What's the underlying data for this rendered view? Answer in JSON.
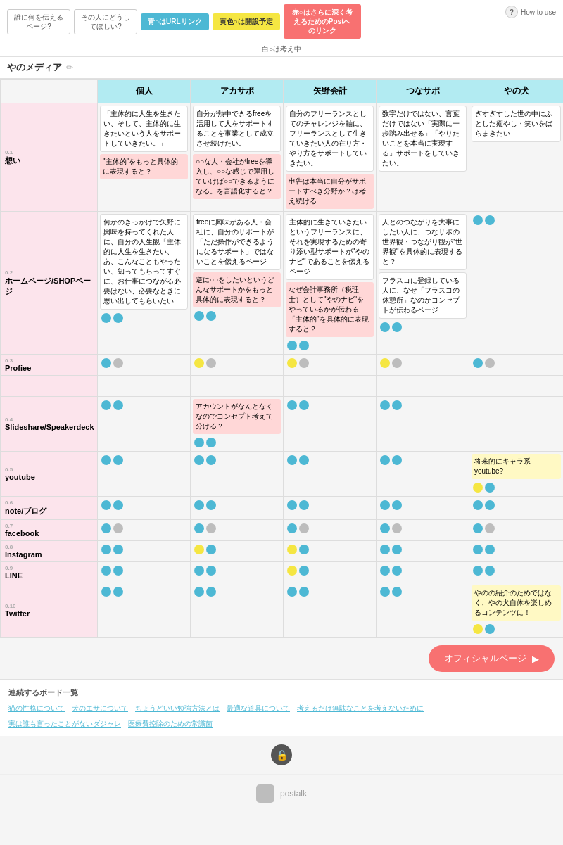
{
  "header": {
    "col_labels": [
      "誰に何を伝えるページ?",
      "その人にどうしてほしい?",
      "青○はURLリンク",
      "黄色○は開設予定",
      "赤○はさらに深く考えるためのPostへのリンク"
    ],
    "white_label": "白○は考え中",
    "howto": "How to use"
  },
  "page_title": "やのメディア",
  "col_headers": [
    "個人",
    "アカサポ",
    "矢野会計",
    "つなサポ",
    "やの犬"
  ],
  "rows": [
    {
      "id": "r1",
      "num": "0.1",
      "label": "想い",
      "cells": [
        {
          "cards": [
            {
              "text": "「主体的に人生を生きたい、そして、主体的に生きたいという人をサポートしていきたい。」",
              "type": "white"
            },
            {
              "text": "\"主体的\"をもっと具体的に表現すると？",
              "type": "pink"
            }
          ],
          "dots": []
        },
        {
          "cards": [
            {
              "text": "自分が熱中できるfreeを活用して人をサポートすることを事業として成立させ続けたい。",
              "type": "white"
            },
            {
              "text": "○○な人・会社がfreeを導入し、○○な感じで運用していけば○○できるようになる。を言語化すると？",
              "type": "pink"
            }
          ],
          "dots": []
        },
        {
          "cards": [
            {
              "text": "自分のフリーランスとしてのチャレンジを軸に、フリーランスとして生きていきたい人の在り方・やり方をサポートしていきたい。",
              "type": "white"
            },
            {
              "text": "申告は本当に自分がサポートすべき分野か？は考え続ける",
              "type": "pink"
            }
          ],
          "dots": []
        },
        {
          "cards": [
            {
              "text": "数字だけではない、言葉だけではない「実際に一歩踏み出せる」「やりたいことを本当に実現する」サポートをしていきたい。",
              "type": "white"
            }
          ],
          "dots": []
        },
        {
          "cards": [
            {
              "text": "ぎすぎすした世の中にふとした癒やし・笑いをばらまきたい",
              "type": "white"
            }
          ],
          "dots": []
        }
      ]
    },
    {
      "id": "r2",
      "num": "0.2",
      "label": "ホームページ/SHOPページ",
      "cells": [
        {
          "cards": [
            {
              "text": "何かのきっかけで矢野に興味を持ってくれた人に、自分の人生観「主体的に人生を生きたい、あ、こんなこともやったい、知ってもらってすぐに、お仕事につながる必要はない、必要なときに思い出してもらいたい",
              "type": "white"
            }
          ],
          "dots": [
            {
              "type": "teal"
            },
            {
              "type": "teal"
            }
          ]
        },
        {
          "cards": [
            {
              "text": "freeに興味がある人・会社に、自分のサポートが「ただ操作ができるようになるサポート」ではないことを伝えるページ",
              "type": "white"
            },
            {
              "text": "逆に○○をしたいという\nどんなサポートかをもっと具体的に表現すると？",
              "type": "pink"
            }
          ],
          "dots": [
            {
              "type": "teal"
            },
            {
              "type": "teal"
            }
          ]
        },
        {
          "cards": [
            {
              "text": "主体的に生きていきたいというフリーランスに、それを実現するための寄り添い型サポートが\"やのナビ\"であることを伝えるページ",
              "type": "white"
            },
            {
              "text": "なぜ会計事務所（税理士）として\"やのナビ\"をやっているかが伝わる「主体的\"を具体的に表現すると？",
              "type": "pink"
            }
          ],
          "dots": [
            {
              "type": "teal"
            },
            {
              "type": "teal"
            }
          ]
        },
        {
          "cards": [
            {
              "text": "人とのつながりを大事にしたい人に、つなサポの世界観・つながり観が\"\"世界観\"を具体的に表現すると？",
              "type": "white"
            },
            {
              "text": "フラスコに登録している人に、なぜ「フラスコの休憩所」なのかコンセプトが伝わるページ",
              "type": "white"
            }
          ],
          "dots": [
            {
              "type": "teal"
            },
            {
              "type": "teal"
            }
          ]
        },
        {
          "cards": [],
          "dots": [
            {
              "type": "teal"
            },
            {
              "type": "teal"
            }
          ]
        }
      ]
    },
    {
      "id": "r3",
      "num": "0.3",
      "label": "Profiee",
      "cells": [
        {
          "cards": [],
          "dots": [
            {
              "type": "teal"
            },
            {
              "type": "gray"
            }
          ]
        },
        {
          "cards": [],
          "dots": [
            {
              "type": "yellow"
            },
            {
              "type": "gray"
            }
          ]
        },
        {
          "cards": [],
          "dots": [
            {
              "type": "yellow"
            },
            {
              "type": "gray"
            }
          ]
        },
        {
          "cards": [],
          "dots": [
            {
              "type": "yellow"
            },
            {
              "type": "gray"
            }
          ]
        },
        {
          "cards": [],
          "dots": [
            {
              "type": "teal"
            },
            {
              "type": "gray"
            }
          ]
        }
      ]
    },
    {
      "id": "r4",
      "num": "",
      "label": "",
      "cells": [
        {
          "cards": [],
          "dots": []
        },
        {
          "cards": [],
          "dots": []
        },
        {
          "cards": [],
          "dots": []
        },
        {
          "cards": [],
          "dots": []
        },
        {
          "cards": [],
          "dots": []
        }
      ]
    },
    {
      "id": "r5",
      "num": "0.4",
      "label": "Slideshare/Speakerdeck",
      "cells": [
        {
          "cards": [],
          "dots": [
            {
              "type": "teal"
            },
            {
              "type": "teal"
            }
          ]
        },
        {
          "cards": [
            {
              "text": "アカウントがなんとなくなのでコンセプト考えて分ける？",
              "type": "pink"
            }
          ],
          "dots": [
            {
              "type": "teal"
            },
            {
              "type": "teal"
            }
          ]
        },
        {
          "cards": [],
          "dots": [
            {
              "type": "teal"
            },
            {
              "type": "teal"
            }
          ]
        },
        {
          "cards": [],
          "dots": [
            {
              "type": "teal"
            },
            {
              "type": "teal"
            }
          ]
        },
        {
          "cards": [],
          "dots": []
        }
      ]
    },
    {
      "id": "r6",
      "num": "0.5",
      "label": "youtube",
      "cells": [
        {
          "cards": [],
          "dots": [
            {
              "type": "teal"
            },
            {
              "type": "teal"
            }
          ]
        },
        {
          "cards": [],
          "dots": [
            {
              "type": "teal"
            },
            {
              "type": "teal"
            }
          ]
        },
        {
          "cards": [],
          "dots": [
            {
              "type": "teal"
            },
            {
              "type": "teal"
            }
          ]
        },
        {
          "cards": [],
          "dots": [
            {
              "type": "teal"
            },
            {
              "type": "teal"
            }
          ]
        },
        {
          "cards": [
            {
              "text": "将来的にキャラ系youtube?",
              "type": "yellow"
            }
          ],
          "dots": [
            {
              "type": "yellow"
            },
            {
              "type": "teal"
            }
          ]
        }
      ]
    },
    {
      "id": "r7",
      "num": "0.6",
      "label": "note/ブログ",
      "cells": [
        {
          "cards": [],
          "dots": [
            {
              "type": "teal"
            },
            {
              "type": "teal"
            }
          ]
        },
        {
          "cards": [],
          "dots": [
            {
              "type": "teal"
            },
            {
              "type": "teal"
            }
          ]
        },
        {
          "cards": [],
          "dots": [
            {
              "type": "teal"
            },
            {
              "type": "teal"
            }
          ]
        },
        {
          "cards": [],
          "dots": [
            {
              "type": "teal"
            },
            {
              "type": "teal"
            }
          ]
        },
        {
          "cards": [],
          "dots": [
            {
              "type": "teal"
            },
            {
              "type": "teal"
            }
          ]
        }
      ]
    },
    {
      "id": "r8",
      "num": "0.7",
      "label": "facebook",
      "cells": [
        {
          "cards": [],
          "dots": [
            {
              "type": "teal"
            },
            {
              "type": "gray"
            }
          ]
        },
        {
          "cards": [],
          "dots": [
            {
              "type": "teal"
            },
            {
              "type": "gray"
            }
          ]
        },
        {
          "cards": [],
          "dots": [
            {
              "type": "teal"
            },
            {
              "type": "gray"
            }
          ]
        },
        {
          "cards": [],
          "dots": [
            {
              "type": "teal"
            },
            {
              "type": "gray"
            }
          ]
        },
        {
          "cards": [],
          "dots": [
            {
              "type": "teal"
            },
            {
              "type": "gray"
            }
          ]
        }
      ]
    },
    {
      "id": "r9",
      "num": "0.8",
      "label": "Instagram",
      "cells": [
        {
          "cards": [],
          "dots": [
            {
              "type": "teal"
            },
            {
              "type": "teal"
            }
          ]
        },
        {
          "cards": [],
          "dots": [
            {
              "type": "yellow"
            },
            {
              "type": "teal"
            }
          ]
        },
        {
          "cards": [],
          "dots": [
            {
              "type": "yellow"
            },
            {
              "type": "teal"
            }
          ]
        },
        {
          "cards": [],
          "dots": [
            {
              "type": "teal"
            },
            {
              "type": "teal"
            }
          ]
        },
        {
          "cards": [],
          "dots": [
            {
              "type": "teal"
            },
            {
              "type": "teal"
            }
          ]
        }
      ]
    },
    {
      "id": "r10",
      "num": "0.9",
      "label": "LINE",
      "cells": [
        {
          "cards": [],
          "dots": [
            {
              "type": "teal"
            },
            {
              "type": "teal"
            }
          ]
        },
        {
          "cards": [],
          "dots": [
            {
              "type": "teal"
            },
            {
              "type": "teal"
            }
          ]
        },
        {
          "cards": [],
          "dots": [
            {
              "type": "yellow"
            },
            {
              "type": "teal"
            }
          ]
        },
        {
          "cards": [],
          "dots": [
            {
              "type": "teal"
            },
            {
              "type": "teal"
            }
          ]
        },
        {
          "cards": [],
          "dots": [
            {
              "type": "teal"
            },
            {
              "type": "teal"
            }
          ]
        }
      ]
    },
    {
      "id": "r11",
      "num": "0.10",
      "label": "Twitter",
      "cells": [
        {
          "cards": [],
          "dots": [
            {
              "type": "teal"
            },
            {
              "type": "teal"
            }
          ]
        },
        {
          "cards": [],
          "dots": [
            {
              "type": "teal"
            },
            {
              "type": "teal"
            }
          ]
        },
        {
          "cards": [],
          "dots": [
            {
              "type": "teal"
            },
            {
              "type": "teal"
            }
          ]
        },
        {
          "cards": [],
          "dots": [
            {
              "type": "teal"
            },
            {
              "type": "teal"
            }
          ]
        },
        {
          "cards": [
            {
              "text": "やのの紹介のためではなく、やの犬自体を楽しめるコンテンツに！",
              "type": "yellow"
            }
          ],
          "dots": [
            {
              "type": "yellow"
            },
            {
              "type": "teal"
            }
          ]
        }
      ]
    }
  ],
  "official_button": "オフィシャルページ",
  "boards_title": "連続するボード一覧",
  "board_links": [
    "猫の性格について",
    "犬のエサについて",
    "ちょうどいい勉強方法とは",
    "最適な道具について",
    "考えるだけ無駄なことを考えないために",
    "実は誰も言ったことがないダジャレ",
    "医療費控除のための常識菌"
  ],
  "footer_brand": "postalk"
}
